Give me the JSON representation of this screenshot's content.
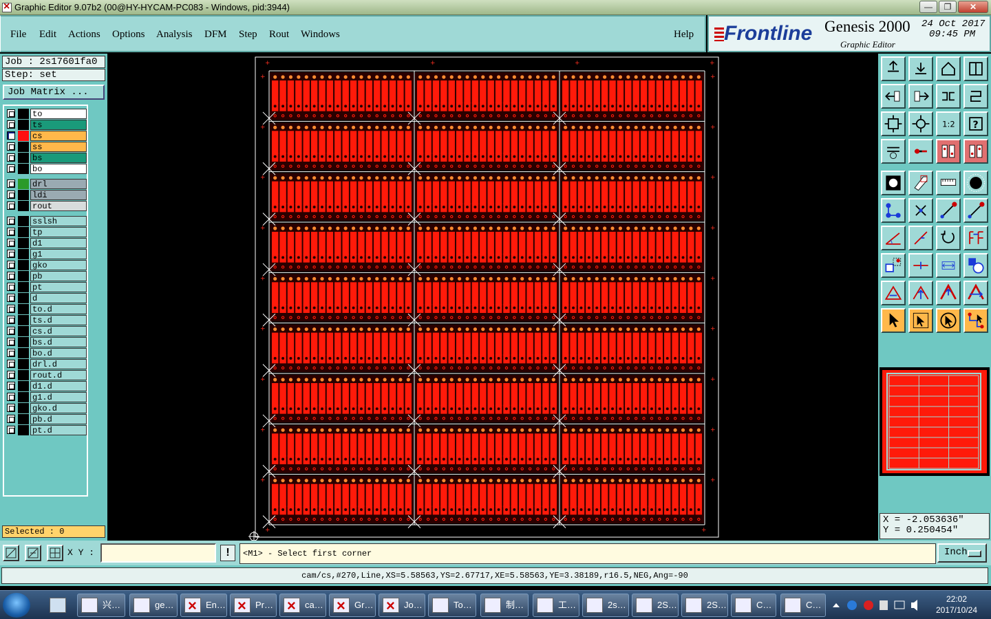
{
  "window": {
    "title": "Graphic Editor 9.07b2 (00@HY-HYCAM-PC083 - Windows, pid:3944)",
    "min": "—",
    "max": "❐",
    "close": "✕"
  },
  "menu": [
    "File",
    "Edit",
    "Actions",
    "Options",
    "Analysis",
    "DFM",
    "Step",
    "Rout",
    "Windows"
  ],
  "help": "Help",
  "brand": {
    "logo": "Frontline",
    "product": "Genesis 2000",
    "subtitle": "Graphic Editor",
    "date": "24 Oct 2017",
    "time": "09:45 PM"
  },
  "job": {
    "job_label": "Job : 2s17601fa0",
    "step_label": "Step: set",
    "matrix_button": "Job Matrix ..."
  },
  "layers": [
    {
      "name": "to",
      "bg": "#ffffff",
      "swatch": "#000000"
    },
    {
      "name": "ts",
      "bg": "#1a9a7a",
      "swatch": "#000000"
    },
    {
      "name": "cs",
      "bg": "#ffb84a",
      "swatch": "#ff1010",
      "active": true
    },
    {
      "name": "ss",
      "bg": "#ffb84a",
      "swatch": "#000000"
    },
    {
      "name": "bs",
      "bg": "#1a9a7a",
      "swatch": "#000000"
    },
    {
      "name": "bo",
      "bg": "#ffffff",
      "swatch": "#000000"
    },
    {
      "name": "drl",
      "bg": "#9aaab2",
      "swatch": "#2a9a2a"
    },
    {
      "name": "ldi",
      "bg": "#9aaab2",
      "swatch": "#000000"
    },
    {
      "name": "rout",
      "bg": "#d8dcdc",
      "swatch": "#000000"
    },
    {
      "name": "sslsh",
      "bg": "#9fd9d6",
      "swatch": "#000000"
    },
    {
      "name": "tp",
      "bg": "#9fd9d6",
      "swatch": "#000000"
    },
    {
      "name": "d1",
      "bg": "#9fd9d6",
      "swatch": "#000000"
    },
    {
      "name": "g1",
      "bg": "#9fd9d6",
      "swatch": "#000000"
    },
    {
      "name": "gko",
      "bg": "#9fd9d6",
      "swatch": "#000000"
    },
    {
      "name": "pb",
      "bg": "#9fd9d6",
      "swatch": "#000000"
    },
    {
      "name": "pt",
      "bg": "#9fd9d6",
      "swatch": "#000000"
    },
    {
      "name": "d",
      "bg": "#9fd9d6",
      "swatch": "#000000"
    },
    {
      "name": "to.d",
      "bg": "#9fd9d6",
      "swatch": "#000000"
    },
    {
      "name": "ts.d",
      "bg": "#9fd9d6",
      "swatch": "#000000"
    },
    {
      "name": "cs.d",
      "bg": "#9fd9d6",
      "swatch": "#000000"
    },
    {
      "name": "bs.d",
      "bg": "#9fd9d6",
      "swatch": "#000000"
    },
    {
      "name": "bo.d",
      "bg": "#9fd9d6",
      "swatch": "#000000"
    },
    {
      "name": "drl.d",
      "bg": "#9fd9d6",
      "swatch": "#000000"
    },
    {
      "name": "rout.d",
      "bg": "#9fd9d6",
      "swatch": "#000000"
    },
    {
      "name": "d1.d",
      "bg": "#9fd9d6",
      "swatch": "#000000"
    },
    {
      "name": "g1.d",
      "bg": "#9fd9d6",
      "swatch": "#000000"
    },
    {
      "name": "gko.d",
      "bg": "#9fd9d6",
      "swatch": "#000000"
    },
    {
      "name": "pb.d",
      "bg": "#9fd9d6",
      "swatch": "#000000"
    },
    {
      "name": "pt.d",
      "bg": "#9fd9d6",
      "swatch": "#000000"
    }
  ],
  "selected": "Selected : 0",
  "board": {
    "rows": 9,
    "cols": 3,
    "copper": "#ff1a0a",
    "pad": "#ff8a30"
  },
  "tool_icons": [
    "home-icon",
    "pan-down-icon",
    "house-icon",
    "window-icon",
    "pan-left-icon",
    "pan-right-icon",
    "flip-icon",
    "snap-icon",
    "zoom-fit-icon",
    "zoom-center-icon",
    "scale-icon",
    "help-icon",
    "measure-icon",
    "probe-icon",
    "layer-compare-icon",
    "layer-compare-2-icon",
    "fill-icon",
    "corner-icon",
    "ruler-icon",
    "circle-icon",
    "move-icon",
    "delete-icon",
    "connect-icon",
    "connect-2-icon",
    "angle-icon",
    "line-icon",
    "arc-icon",
    "text-icon",
    "copy-icon",
    "cut-line-icon",
    "dimension-icon",
    "shapes-icon",
    "arc-add-icon",
    "arc-select-icon",
    "arc-edit-icon",
    "arc-move-icon",
    "pointer-icon",
    "pointer-box-icon",
    "pointer-circle-icon",
    "pointer-net-icon"
  ],
  "coords": {
    "x": "X = -2.053636\"",
    "y": "Y = 0.250454\""
  },
  "input": {
    "xy_label": "X Y :",
    "bang": "!",
    "prompt": "<M1> - Select first corner",
    "units": "Inch"
  },
  "status": "cam/cs,#270,Line,XS=5.58563,YS=2.67717,XE=5.58563,YE=3.38189,r16.5,NEG,Ang=-90",
  "taskbar": {
    "apps": [
      "兴…",
      "ge…",
      "En…",
      "Pr…",
      "ca…",
      "Gr…",
      "Jo…",
      "To…",
      "制…",
      "工…",
      "2s…",
      "2S…",
      "2S…",
      "C…",
      "C…"
    ],
    "time": "22:02",
    "date": "2017/10/24"
  }
}
